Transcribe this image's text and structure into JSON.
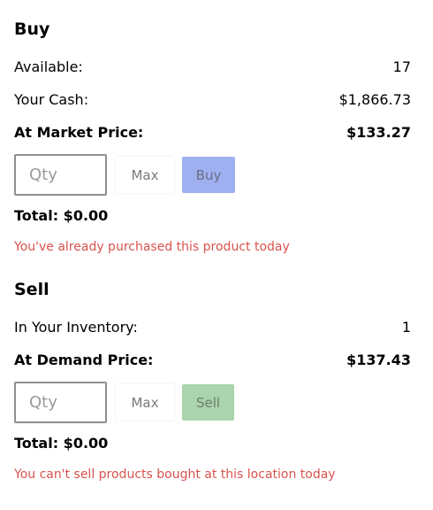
{
  "buy": {
    "title": "Buy",
    "available_label": "Available:",
    "available_value": "17",
    "cash_label": "Your Cash:",
    "cash_value": "$1,866.73",
    "price_label": "At Market Price:",
    "price_value": "$133.27",
    "qty_placeholder": "Qty",
    "max_label": "Max",
    "action_label": "Buy",
    "total_text": "Total: $0.00",
    "error_text": "You've already purchased this product today"
  },
  "sell": {
    "title": "Sell",
    "inventory_label": "In Your Inventory:",
    "inventory_value": "1",
    "price_label": "At Demand Price:",
    "price_value": "$137.43",
    "qty_placeholder": "Qty",
    "max_label": "Max",
    "action_label": "Sell",
    "total_text": "Total: $0.00",
    "error_text": "You can't sell products bought at this location today"
  },
  "colors": {
    "buy_button": "#9fb0f0",
    "sell_button": "#a9d4ad",
    "error": "#d9534f"
  }
}
